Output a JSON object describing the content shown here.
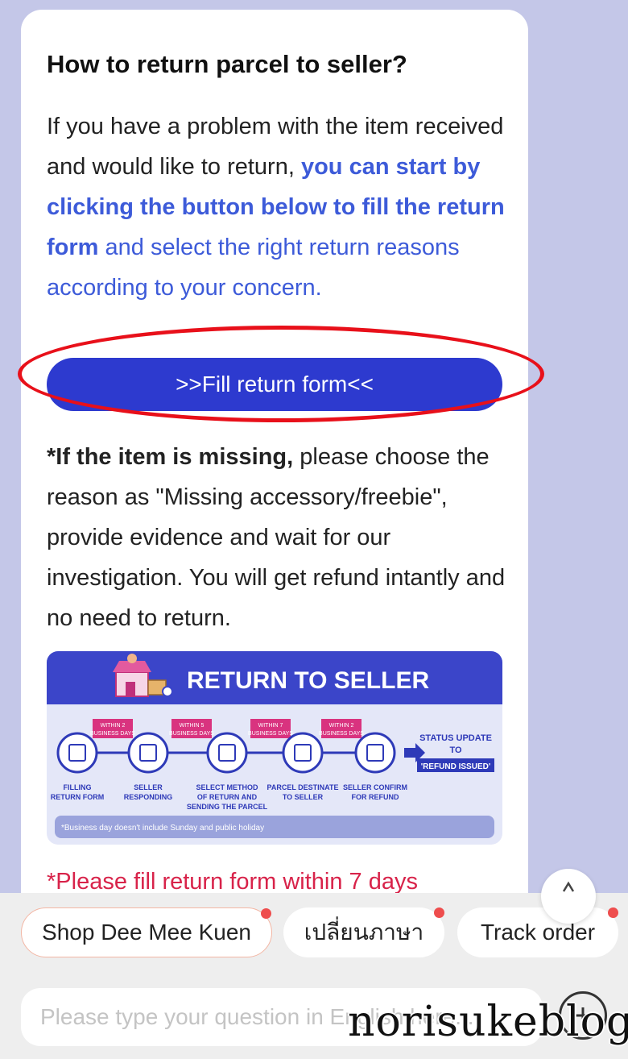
{
  "message": {
    "title": "How to return parcel to seller?",
    "intro_part1": "If you have a problem with the item received and would like to return, ",
    "intro_bold": "you can start by clicking the button below to fill the return form",
    "intro_part2": " and select the right return reasons according to your concern.",
    "fill_button_label": ">>Fill return form<<",
    "missing_bold": "*If the item is missing,",
    "missing_text": " please choose the reason as \"Missing accessory/freebie\", provide evidence and wait for our investigation. You will get refund intantly and no need to return.",
    "warning": "*Please fill return form within 7 days"
  },
  "infographic": {
    "title": "RETURN TO SELLER",
    "badges": [
      "WITHIN 2\nBUSINESS DAYS",
      "WITHIN 5\nBUSINESS DAYS",
      "WITHIN 7\nBUSINESS DAYS",
      "WITHIN 2\nBUSINESS DAYS"
    ],
    "steps": [
      "FILLING\nRETURN FORM",
      "SELLER\nRESPONDING",
      "SELECT METHOD\nOF RETURN AND\nSENDING THE PARCEL",
      "PARCEL DESTINATE\nTO SELLER",
      "SELLER CONFIRM\nFOR REFUND"
    ],
    "status_line1": "STATUS UPDATE",
    "status_line2": "TO",
    "status_tag": "'REFUND ISSUED'",
    "footnote": "*Business day doesn't include Sunday and public holiday",
    "colors": {
      "header": "#3b45c9",
      "badge": "#d9337f",
      "circle": "#2e3ab8",
      "band": "#9aa3dc"
    }
  },
  "quick_replies": [
    {
      "label": "Shop Dee Mee Kuen"
    },
    {
      "label": "เปลี่ยนภาษา"
    },
    {
      "label": "Track order"
    }
  ],
  "input": {
    "placeholder": "Please type your question in English here..."
  },
  "colors": {
    "accent": "#2d3acf",
    "link": "#3d5bd9",
    "warning": "#d8234a",
    "highlight_ring": "#e8101a",
    "background": "#c4c7e8"
  },
  "watermark": "norisukeblog"
}
